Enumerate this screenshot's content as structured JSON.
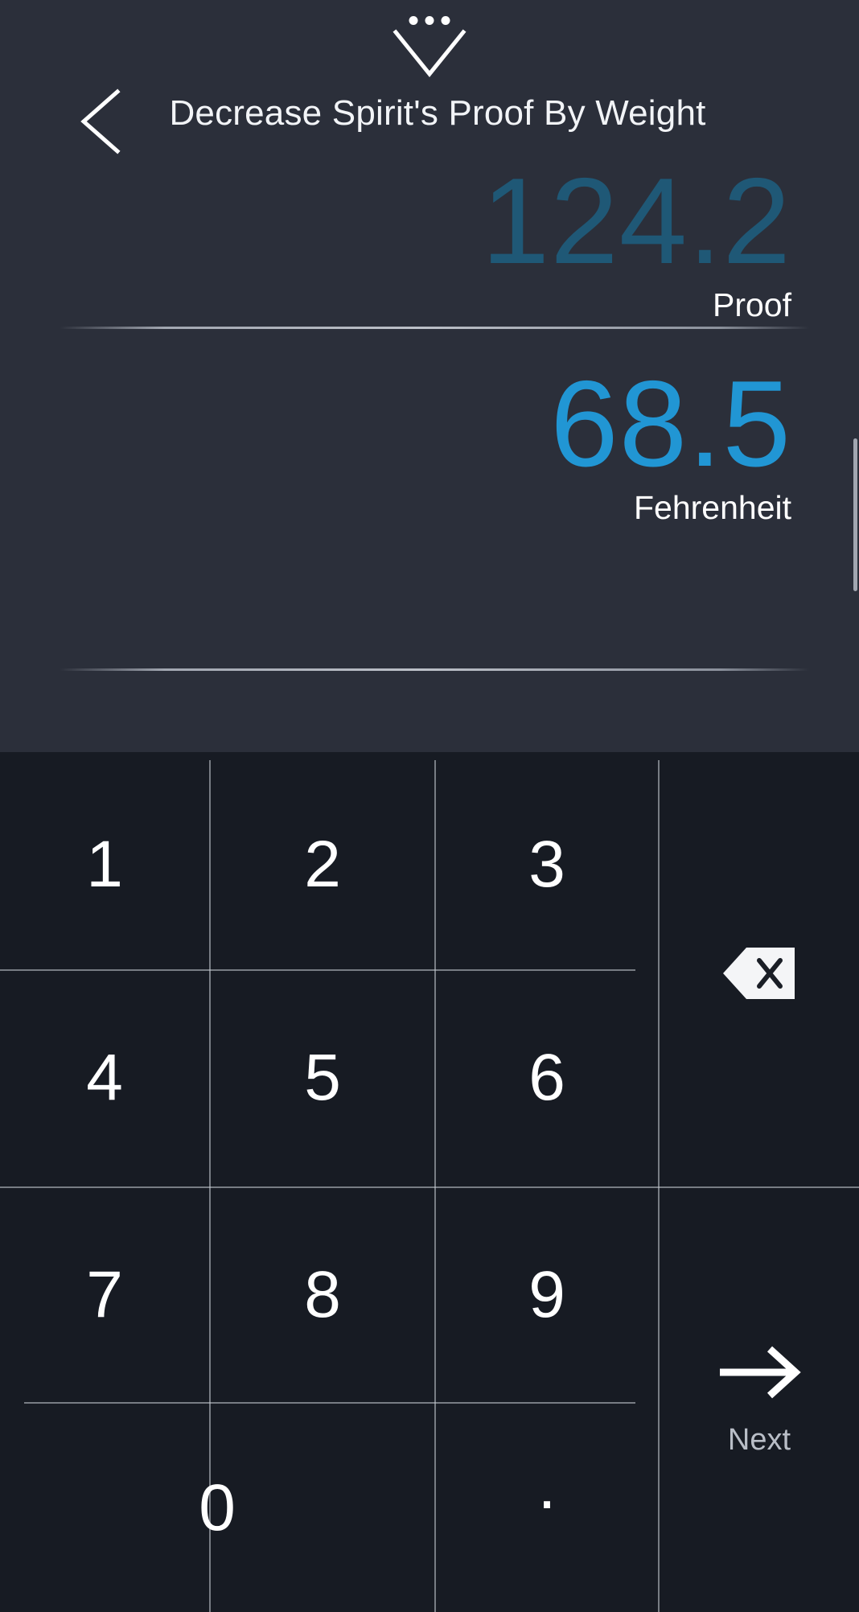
{
  "header": {
    "title": "Decrease Spirit's Proof By Weight",
    "back_icon": "chevron-left-icon",
    "handle_icon": "chevron-down-icon",
    "menu_dots_icon": "more-dots-icon"
  },
  "display": {
    "fields": [
      {
        "value": "124.2",
        "unit": "Proof",
        "state": "inactive",
        "color": "#1f5876"
      },
      {
        "value": "68.5",
        "unit": "Fehrenheit",
        "state": "active",
        "color": "#2196d4"
      }
    ]
  },
  "keypad": {
    "keys": [
      {
        "label": "1"
      },
      {
        "label": "2"
      },
      {
        "label": "3"
      },
      {
        "label": "4"
      },
      {
        "label": "5"
      },
      {
        "label": "6"
      },
      {
        "label": "7"
      },
      {
        "label": "8"
      },
      {
        "label": "9"
      },
      {
        "label": "0"
      },
      {
        "label": "."
      }
    ],
    "backspace_icon": "backspace-icon",
    "next_icon": "arrow-right-icon",
    "next_label": "Next"
  },
  "colors": {
    "panel_bg": "#2b2f3a",
    "keypad_bg": "#171b23",
    "accent": "#2196d4",
    "accent_dim": "#1f5876",
    "text": "#ffffff",
    "muted": "#b9bec7"
  }
}
